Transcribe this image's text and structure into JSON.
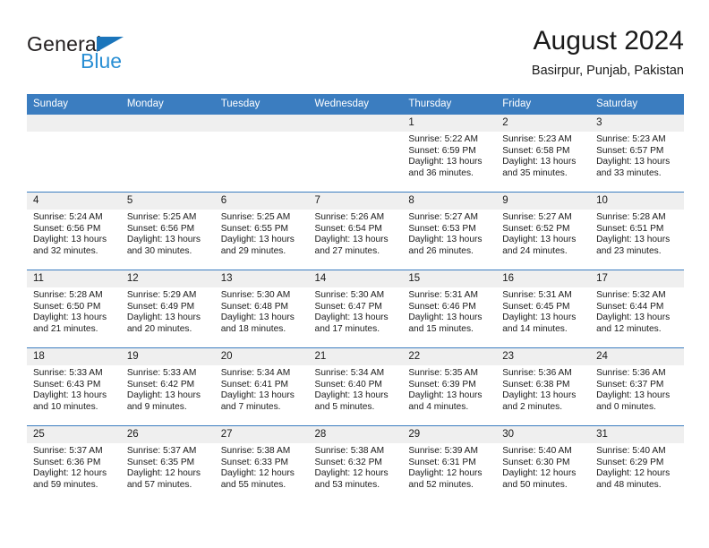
{
  "logo": {
    "word_one": "General",
    "word_two": "Blue",
    "flag_icon": "triangle-flag-icon",
    "brand_blue": "#1b75bb",
    "brand_light_blue": "#2a8fd4"
  },
  "header": {
    "title": "August 2024",
    "location": "Basirpur, Punjab, Pakistan"
  },
  "theme": {
    "header_bar": "#3b7dc0",
    "daynum_strip": "#efefef",
    "text": "#1a1a1a"
  },
  "weekday_headers": [
    "Sunday",
    "Monday",
    "Tuesday",
    "Wednesday",
    "Thursday",
    "Friday",
    "Saturday"
  ],
  "weeks": [
    [
      {
        "day": "",
        "blank": true,
        "sunrise": "",
        "sunset": "",
        "daylight_line1": "",
        "daylight_line2": ""
      },
      {
        "day": "",
        "blank": true,
        "sunrise": "",
        "sunset": "",
        "daylight_line1": "",
        "daylight_line2": ""
      },
      {
        "day": "",
        "blank": true,
        "sunrise": "",
        "sunset": "",
        "daylight_line1": "",
        "daylight_line2": ""
      },
      {
        "day": "",
        "blank": true,
        "sunrise": "",
        "sunset": "",
        "daylight_line1": "",
        "daylight_line2": ""
      },
      {
        "day": "1",
        "blank": false,
        "sunrise": "Sunrise: 5:22 AM",
        "sunset": "Sunset: 6:59 PM",
        "daylight_line1": "Daylight: 13 hours",
        "daylight_line2": "and 36 minutes."
      },
      {
        "day": "2",
        "blank": false,
        "sunrise": "Sunrise: 5:23 AM",
        "sunset": "Sunset: 6:58 PM",
        "daylight_line1": "Daylight: 13 hours",
        "daylight_line2": "and 35 minutes."
      },
      {
        "day": "3",
        "blank": false,
        "sunrise": "Sunrise: 5:23 AM",
        "sunset": "Sunset: 6:57 PM",
        "daylight_line1": "Daylight: 13 hours",
        "daylight_line2": "and 33 minutes."
      }
    ],
    [
      {
        "day": "4",
        "blank": false,
        "sunrise": "Sunrise: 5:24 AM",
        "sunset": "Sunset: 6:56 PM",
        "daylight_line1": "Daylight: 13 hours",
        "daylight_line2": "and 32 minutes."
      },
      {
        "day": "5",
        "blank": false,
        "sunrise": "Sunrise: 5:25 AM",
        "sunset": "Sunset: 6:56 PM",
        "daylight_line1": "Daylight: 13 hours",
        "daylight_line2": "and 30 minutes."
      },
      {
        "day": "6",
        "blank": false,
        "sunrise": "Sunrise: 5:25 AM",
        "sunset": "Sunset: 6:55 PM",
        "daylight_line1": "Daylight: 13 hours",
        "daylight_line2": "and 29 minutes."
      },
      {
        "day": "7",
        "blank": false,
        "sunrise": "Sunrise: 5:26 AM",
        "sunset": "Sunset: 6:54 PM",
        "daylight_line1": "Daylight: 13 hours",
        "daylight_line2": "and 27 minutes."
      },
      {
        "day": "8",
        "blank": false,
        "sunrise": "Sunrise: 5:27 AM",
        "sunset": "Sunset: 6:53 PM",
        "daylight_line1": "Daylight: 13 hours",
        "daylight_line2": "and 26 minutes."
      },
      {
        "day": "9",
        "blank": false,
        "sunrise": "Sunrise: 5:27 AM",
        "sunset": "Sunset: 6:52 PM",
        "daylight_line1": "Daylight: 13 hours",
        "daylight_line2": "and 24 minutes."
      },
      {
        "day": "10",
        "blank": false,
        "sunrise": "Sunrise: 5:28 AM",
        "sunset": "Sunset: 6:51 PM",
        "daylight_line1": "Daylight: 13 hours",
        "daylight_line2": "and 23 minutes."
      }
    ],
    [
      {
        "day": "11",
        "blank": false,
        "sunrise": "Sunrise: 5:28 AM",
        "sunset": "Sunset: 6:50 PM",
        "daylight_line1": "Daylight: 13 hours",
        "daylight_line2": "and 21 minutes."
      },
      {
        "day": "12",
        "blank": false,
        "sunrise": "Sunrise: 5:29 AM",
        "sunset": "Sunset: 6:49 PM",
        "daylight_line1": "Daylight: 13 hours",
        "daylight_line2": "and 20 minutes."
      },
      {
        "day": "13",
        "blank": false,
        "sunrise": "Sunrise: 5:30 AM",
        "sunset": "Sunset: 6:48 PM",
        "daylight_line1": "Daylight: 13 hours",
        "daylight_line2": "and 18 minutes."
      },
      {
        "day": "14",
        "blank": false,
        "sunrise": "Sunrise: 5:30 AM",
        "sunset": "Sunset: 6:47 PM",
        "daylight_line1": "Daylight: 13 hours",
        "daylight_line2": "and 17 minutes."
      },
      {
        "day": "15",
        "blank": false,
        "sunrise": "Sunrise: 5:31 AM",
        "sunset": "Sunset: 6:46 PM",
        "daylight_line1": "Daylight: 13 hours",
        "daylight_line2": "and 15 minutes."
      },
      {
        "day": "16",
        "blank": false,
        "sunrise": "Sunrise: 5:31 AM",
        "sunset": "Sunset: 6:45 PM",
        "daylight_line1": "Daylight: 13 hours",
        "daylight_line2": "and 14 minutes."
      },
      {
        "day": "17",
        "blank": false,
        "sunrise": "Sunrise: 5:32 AM",
        "sunset": "Sunset: 6:44 PM",
        "daylight_line1": "Daylight: 13 hours",
        "daylight_line2": "and 12 minutes."
      }
    ],
    [
      {
        "day": "18",
        "blank": false,
        "sunrise": "Sunrise: 5:33 AM",
        "sunset": "Sunset: 6:43 PM",
        "daylight_line1": "Daylight: 13 hours",
        "daylight_line2": "and 10 minutes."
      },
      {
        "day": "19",
        "blank": false,
        "sunrise": "Sunrise: 5:33 AM",
        "sunset": "Sunset: 6:42 PM",
        "daylight_line1": "Daylight: 13 hours",
        "daylight_line2": "and 9 minutes."
      },
      {
        "day": "20",
        "blank": false,
        "sunrise": "Sunrise: 5:34 AM",
        "sunset": "Sunset: 6:41 PM",
        "daylight_line1": "Daylight: 13 hours",
        "daylight_line2": "and 7 minutes."
      },
      {
        "day": "21",
        "blank": false,
        "sunrise": "Sunrise: 5:34 AM",
        "sunset": "Sunset: 6:40 PM",
        "daylight_line1": "Daylight: 13 hours",
        "daylight_line2": "and 5 minutes."
      },
      {
        "day": "22",
        "blank": false,
        "sunrise": "Sunrise: 5:35 AM",
        "sunset": "Sunset: 6:39 PM",
        "daylight_line1": "Daylight: 13 hours",
        "daylight_line2": "and 4 minutes."
      },
      {
        "day": "23",
        "blank": false,
        "sunrise": "Sunrise: 5:36 AM",
        "sunset": "Sunset: 6:38 PM",
        "daylight_line1": "Daylight: 13 hours",
        "daylight_line2": "and 2 minutes."
      },
      {
        "day": "24",
        "blank": false,
        "sunrise": "Sunrise: 5:36 AM",
        "sunset": "Sunset: 6:37 PM",
        "daylight_line1": "Daylight: 13 hours",
        "daylight_line2": "and 0 minutes."
      }
    ],
    [
      {
        "day": "25",
        "blank": false,
        "sunrise": "Sunrise: 5:37 AM",
        "sunset": "Sunset: 6:36 PM",
        "daylight_line1": "Daylight: 12 hours",
        "daylight_line2": "and 59 minutes."
      },
      {
        "day": "26",
        "blank": false,
        "sunrise": "Sunrise: 5:37 AM",
        "sunset": "Sunset: 6:35 PM",
        "daylight_line1": "Daylight: 12 hours",
        "daylight_line2": "and 57 minutes."
      },
      {
        "day": "27",
        "blank": false,
        "sunrise": "Sunrise: 5:38 AM",
        "sunset": "Sunset: 6:33 PM",
        "daylight_line1": "Daylight: 12 hours",
        "daylight_line2": "and 55 minutes."
      },
      {
        "day": "28",
        "blank": false,
        "sunrise": "Sunrise: 5:38 AM",
        "sunset": "Sunset: 6:32 PM",
        "daylight_line1": "Daylight: 12 hours",
        "daylight_line2": "and 53 minutes."
      },
      {
        "day": "29",
        "blank": false,
        "sunrise": "Sunrise: 5:39 AM",
        "sunset": "Sunset: 6:31 PM",
        "daylight_line1": "Daylight: 12 hours",
        "daylight_line2": "and 52 minutes."
      },
      {
        "day": "30",
        "blank": false,
        "sunrise": "Sunrise: 5:40 AM",
        "sunset": "Sunset: 6:30 PM",
        "daylight_line1": "Daylight: 12 hours",
        "daylight_line2": "and 50 minutes."
      },
      {
        "day": "31",
        "blank": false,
        "sunrise": "Sunrise: 5:40 AM",
        "sunset": "Sunset: 6:29 PM",
        "daylight_line1": "Daylight: 12 hours",
        "daylight_line2": "and 48 minutes."
      }
    ]
  ]
}
